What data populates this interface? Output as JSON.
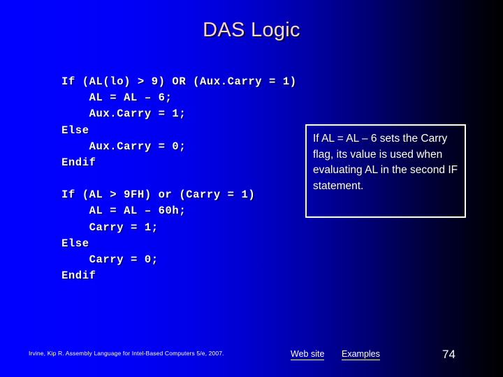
{
  "slide": {
    "title": "DAS Logic",
    "page_number": "74",
    "accent_underline_color": "#ffff66",
    "title_color": "#fbd9bd",
    "background_start_color": "#0000ff",
    "background_end_color": "#000000"
  },
  "code_blocks": [
    {
      "id": "aux-carry-block",
      "lines": [
        "If (AL(lo) > 9) OR (Aux.Carry = 1)",
        "    AL = AL – 6;",
        "    Aux.Carry = 1;",
        "Else",
        "    Aux.Carry = 0;",
        "Endif"
      ]
    },
    {
      "id": "carry-block",
      "lines": [
        "If (AL > 9FH) or (Carry = 1)",
        "    AL = AL – 60h;",
        "    Carry = 1;",
        "Else",
        "    Carry = 0;",
        "Endif"
      ]
    }
  ],
  "callout": {
    "text": "If AL = AL – 6 sets the Carry flag, its value is used when evaluating AL in the second IF statement."
  },
  "footer": {
    "credit": "Irvine, Kip R. Assembly Language for Intel-Based Computers 5/e, 2007.",
    "links": [
      {
        "label": "Web site"
      },
      {
        "label": "Examples"
      }
    ]
  }
}
